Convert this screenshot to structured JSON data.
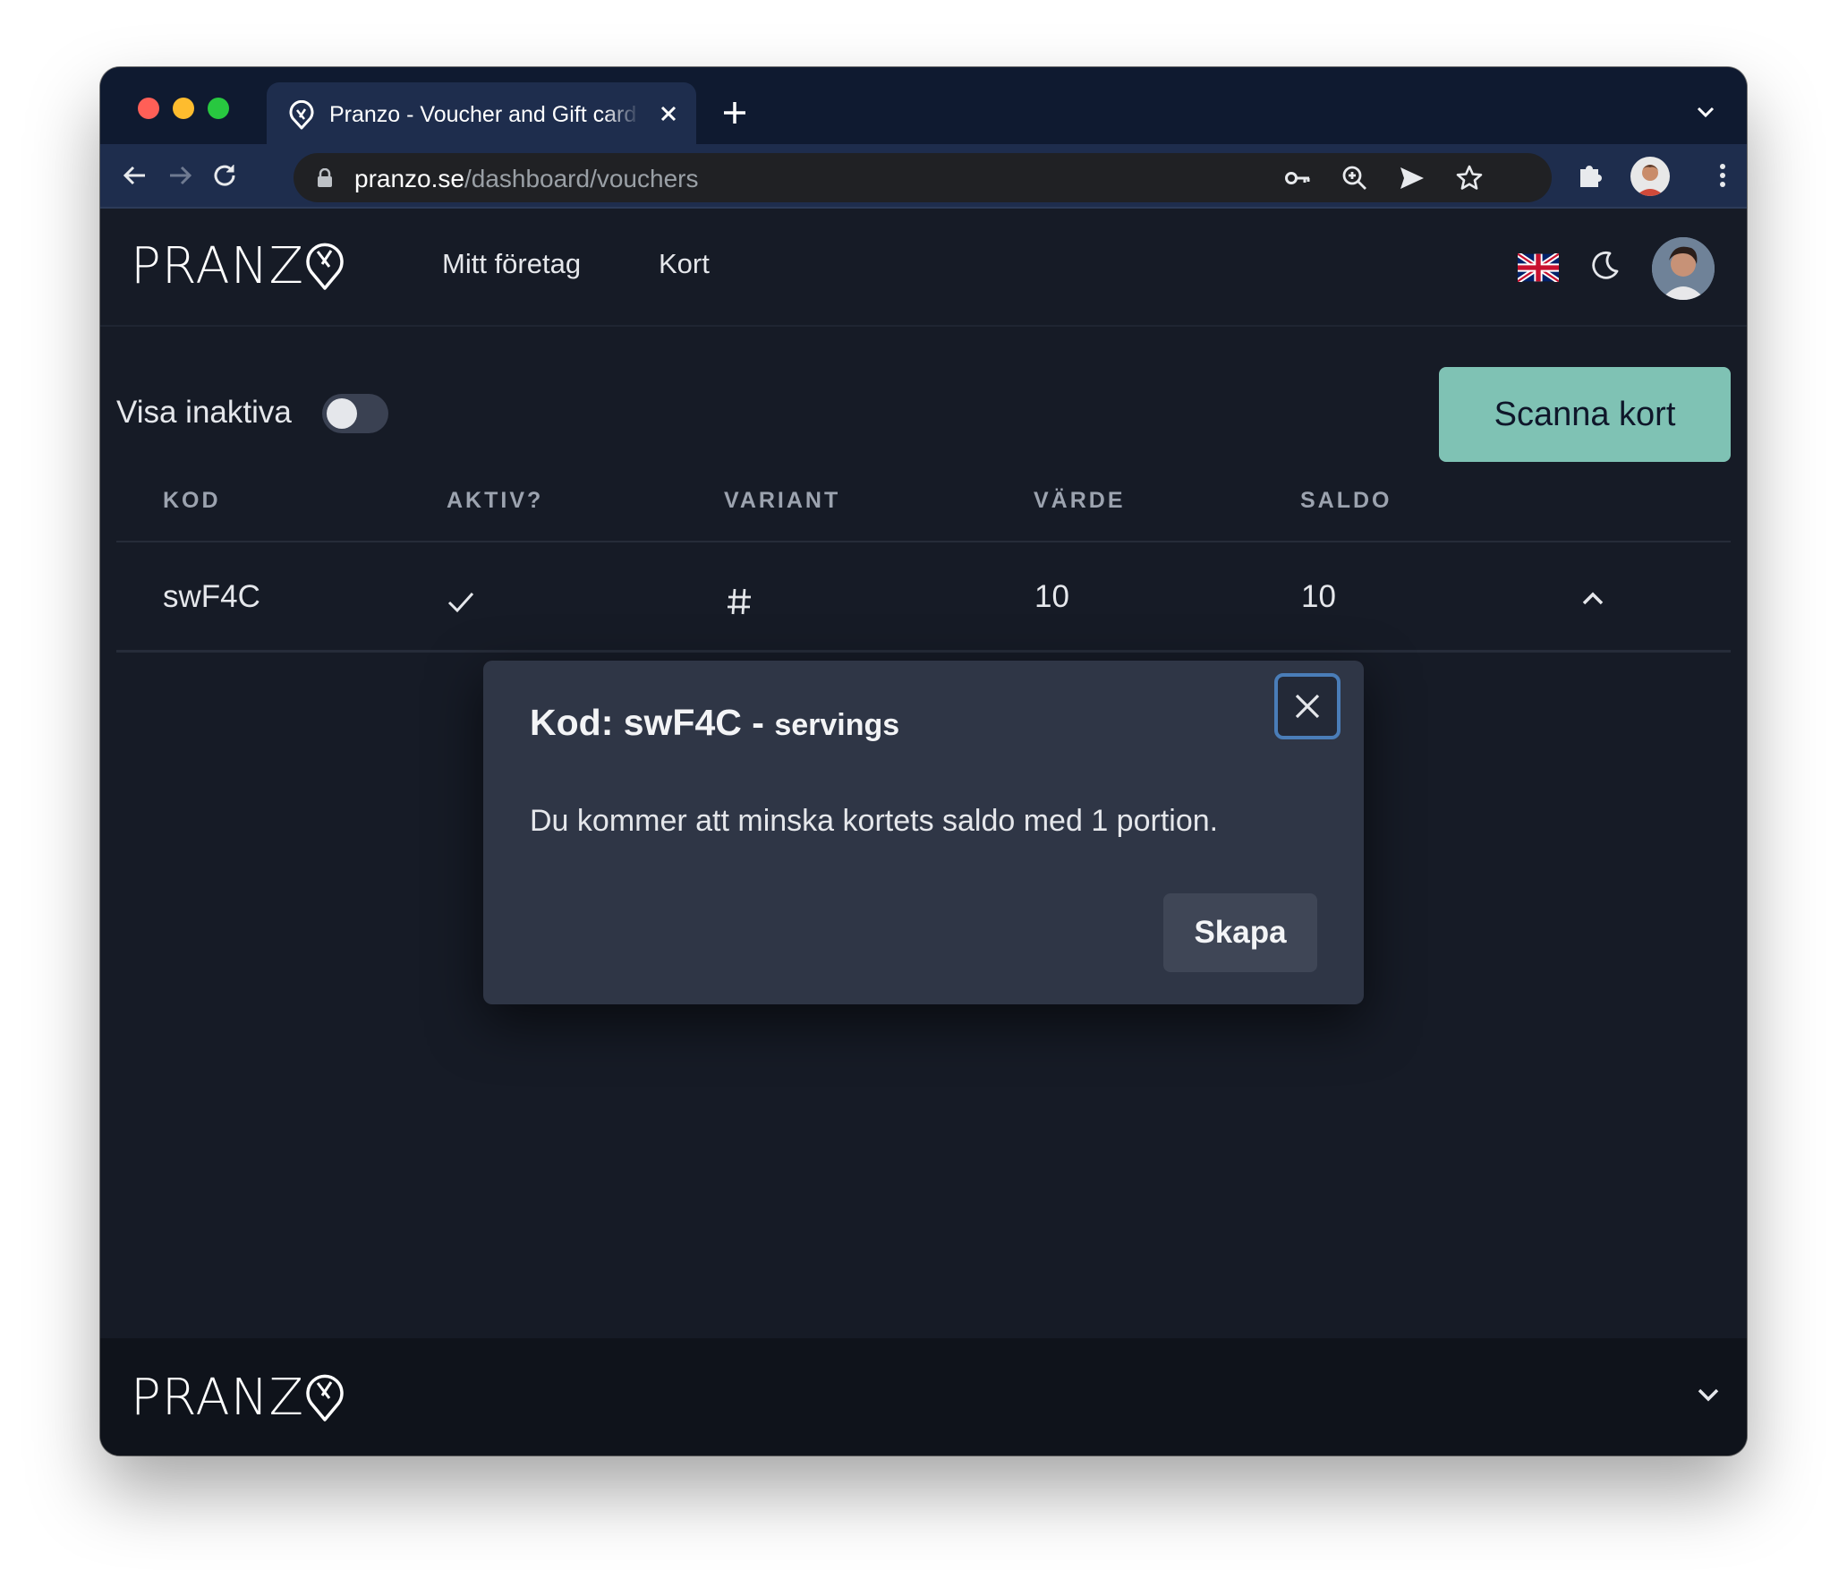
{
  "browser": {
    "tab_title": "Pranzo - Voucher and Gift card",
    "url_host": "pranzo.se",
    "url_path": "/dashboard/vouchers"
  },
  "header": {
    "logo_text": "PRANZ",
    "nav": [
      "Mitt företag",
      "Kort"
    ]
  },
  "toolbar": {
    "toggle_label": "Visa inaktiva",
    "scan_button": "Scanna kort"
  },
  "table": {
    "columns": [
      "KOD",
      "AKTIV?",
      "VARIANT",
      "VÄRDE",
      "SALDO"
    ],
    "rows": [
      {
        "code": "swF4C",
        "active_icon": "check-icon",
        "variant_icon": "hash-icon",
        "value": "10",
        "balance": "10"
      }
    ]
  },
  "modal": {
    "title": "Kod: swF4C -",
    "subtitle": "servings",
    "body": "Du kommer att minska kortets saldo med 1 portion.",
    "button": "Skapa"
  },
  "footer": {
    "logo_text": "PRANZ"
  },
  "colors": {
    "accent": "#7fc2b4",
    "page_bg": "#161b26",
    "modal_bg": "#2f3646",
    "tabstrip_bg": "#0f1a30"
  }
}
